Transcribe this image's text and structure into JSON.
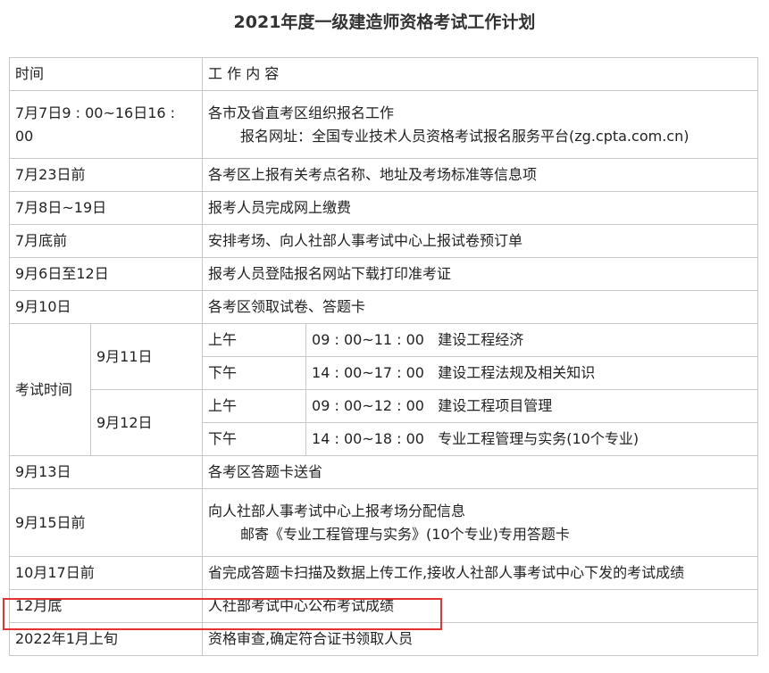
{
  "title": "2021年度一级建造师资格考试工作计划",
  "header": {
    "col_time": "时间",
    "col_content": "工 作 内 容"
  },
  "rows_before": [
    {
      "time": "7月7日9 : 00~16日16 : 00",
      "content": "各市及省直考区组织报名工作",
      "content2": "报名网址：全国专业技术人员资格考试报名服务平台(zg.cpta.com.cn)"
    },
    {
      "time": "7月23日前",
      "content": "各考区上报有关考点名称、地址及考场标准等信息项"
    },
    {
      "time": "7月8日~19日",
      "content": "报考人员完成网上缴费"
    },
    {
      "time": "7月底前",
      "content": "安排考场、向人社部人事考试中心上报试卷预订单"
    },
    {
      "time": "9月6日至12日",
      "content": "报考人员登陆报名网站下载打印准考证"
    },
    {
      "time": "9月10日",
      "content": "各考区领取试卷、答题卡"
    }
  ],
  "exam": {
    "label": "考试时间",
    "days": [
      {
        "date": "9月11日",
        "sessions": [
          {
            "period": "上午",
            "time": "09 : 00~11 : 00",
            "subject": "建设工程经济"
          },
          {
            "period": "下午",
            "time": "14 : 00~17 : 00",
            "subject": "建设工程法规及相关知识"
          }
        ]
      },
      {
        "date": "9月12日",
        "sessions": [
          {
            "period": "上午",
            "time": "09 : 00~12 : 00",
            "subject": "建设工程项目管理"
          },
          {
            "period": "下午",
            "time": "14 : 00~18 : 00",
            "subject": "专业工程管理与实务(10个专业)"
          }
        ]
      }
    ]
  },
  "rows_after": [
    {
      "time": "9月13日",
      "content": "各考区答题卡送省"
    },
    {
      "time": "9月15日前",
      "content": "向人社部人事考试中心上报考场分配信息",
      "content2": "邮寄《专业工程管理与实务》(10个专业)专用答题卡"
    },
    {
      "time": "10月17日前",
      "content": "省完成答题卡扫描及数据上传工作,接收人社部人事考试中心下发的考试成绩"
    },
    {
      "time": "12月底",
      "content": "人社部考试中心公布考试成绩"
    },
    {
      "time": "2022年1月上旬",
      "content": "资格审查,确定符合证书领取人员"
    }
  ],
  "highlight_color": "#e63232"
}
